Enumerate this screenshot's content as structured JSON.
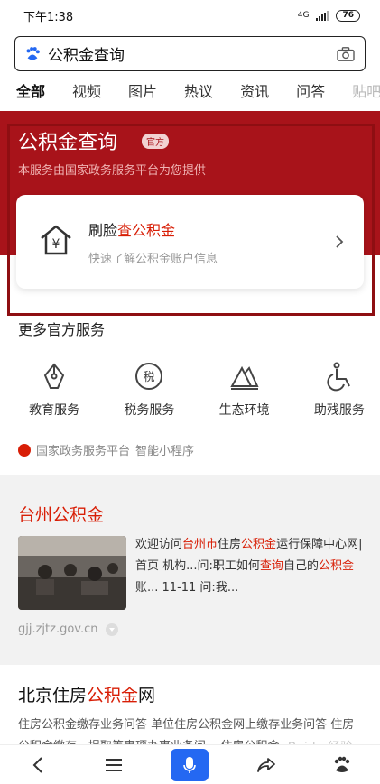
{
  "status": {
    "time": "下午1:38",
    "network": "4G",
    "battery": "76"
  },
  "search": {
    "query": "公积金查询"
  },
  "tabs": [
    "全部",
    "视频",
    "图片",
    "热议",
    "资讯",
    "问答",
    "贴吧"
  ],
  "hero": {
    "title": "公积金查询",
    "badge": "官方",
    "subtitle": "本服务由国家政务服务平台为您提供"
  },
  "card": {
    "title_prefix": "刷脸",
    "title_highlight": "查公积金",
    "subtitle": "快速了解公积金账户信息",
    "icon_glyph": "¥"
  },
  "more": {
    "title": "更多官方服务",
    "items": [
      {
        "label": "教育服务",
        "icon": "pen-nib-icon"
      },
      {
        "label": "税务服务",
        "icon": "tax-icon",
        "glyph": "税"
      },
      {
        "label": "生态环境",
        "icon": "mountain-icon"
      },
      {
        "label": "助残服务",
        "icon": "wheelchair-icon"
      }
    ],
    "platform": "国家政务服务平台",
    "mini_program": "智能小程序"
  },
  "result1": {
    "title": "台州公积金",
    "desc_parts": [
      {
        "t": "欢迎访问",
        "hl": false
      },
      {
        "t": "台州市",
        "hl": true
      },
      {
        "t": "住房",
        "hl": false
      },
      {
        "t": "公积金",
        "hl": true
      },
      {
        "t": "运行保障中心网|首页 机构...问:职工如何",
        "hl": false
      },
      {
        "t": "查询",
        "hl": true
      },
      {
        "t": "自己的",
        "hl": false
      },
      {
        "t": "公积金",
        "hl": true
      },
      {
        "t": "账... 11-11 问:我...",
        "hl": false
      }
    ],
    "site": "gjj.zjtz.gov.cn"
  },
  "result2": {
    "title_prefix": "北京住房",
    "title_highlight": "公积金",
    "title_suffix": "网",
    "desc": "住房公积金缴存业务问答 单位住房公积金网上缴存业务问答 住房公积金缴存、提取等事项办事业务问... 住房公积金"
  },
  "watermark": "Baidu 经验",
  "colors": {
    "brand_red": "#a8131a",
    "highlight": "#d81e06",
    "blue": "#2468f2"
  }
}
